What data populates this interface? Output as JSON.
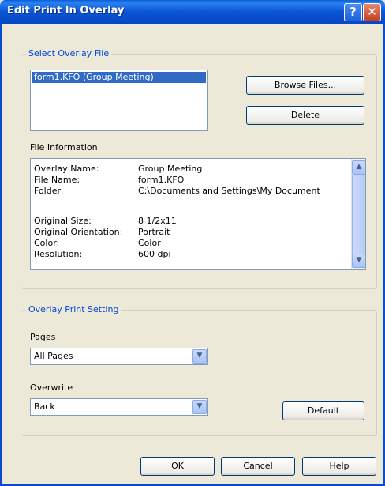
{
  "window": {
    "title": "Edit Print In Overlay",
    "help_glyph": "?",
    "close_glyph": "✕"
  },
  "overlay_file": {
    "legend": "Select Overlay File",
    "files": [
      "form1.KFO (Group Meeting)"
    ],
    "browse_label": "Browse Files...",
    "delete_label": "Delete"
  },
  "file_info": {
    "heading": "File Information",
    "rows": [
      {
        "key": "Overlay Name:",
        "value": "Group Meeting"
      },
      {
        "key": "File Name:",
        "value": "form1.KFO"
      },
      {
        "key": "Folder:",
        "value": "C:\\Documents and Settings\\My Document"
      },
      {
        "key": "Original Size:",
        "value": "8 1/2x11"
      },
      {
        "key": "Original Orientation:",
        "value": "Portrait"
      },
      {
        "key": "Color:",
        "value": "Color"
      },
      {
        "key": "Resolution:",
        "value": "600 dpi"
      }
    ]
  },
  "print_setting": {
    "legend": "Overlay Print Setting",
    "pages_label": "Pages",
    "pages_value": "All Pages",
    "overwrite_label": "Overwrite",
    "overwrite_value": "Back",
    "default_label": "Default"
  },
  "footer": {
    "ok": "OK",
    "cancel": "Cancel",
    "help": "Help"
  },
  "icons": {
    "up": "▲",
    "down": "▼",
    "thumb_grip": "≡"
  },
  "colors": {
    "title_bar": "#0b55d6",
    "selection": "#316ac5",
    "legend_text": "#0046d5"
  }
}
